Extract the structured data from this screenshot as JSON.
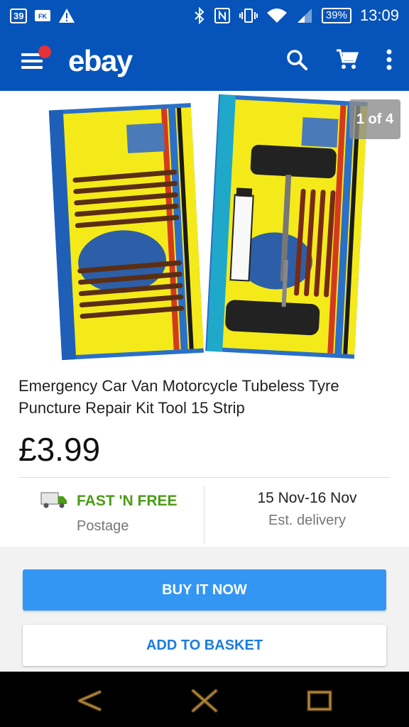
{
  "status_bar": {
    "notif_count": "39",
    "battery": "39%",
    "time": "13:09",
    "icons": [
      "badge-39-icon",
      "fk-icon",
      "warning-icon",
      "bluetooth-icon",
      "nfc-icon",
      "vibrate-icon",
      "wifi-icon",
      "signal-icon",
      "battery-icon"
    ]
  },
  "app_bar": {
    "logo": "ebay",
    "icons": [
      "menu-icon",
      "search-icon",
      "cart-icon",
      "more-vert-icon"
    ]
  },
  "gallery": {
    "counter": "1 of 4"
  },
  "item": {
    "title": "Emergency Car Van Motorcycle Tubeless Tyre Puncture Repair Kit Tool 15 Strip",
    "price": "£3.99"
  },
  "shipping": {
    "badge": "FAST 'N FREE",
    "label": "Postage"
  },
  "delivery": {
    "dates": "15 Nov-16 Nov",
    "label": "Est. delivery"
  },
  "actions": {
    "buy_now": "BUY IT NOW",
    "add_to_basket": "ADD TO BASKET"
  },
  "nav_bar": {
    "icons": [
      "back-icon",
      "home-icon",
      "recents-icon"
    ]
  },
  "colors": {
    "brand_blue": "#0654ba",
    "button_blue": "#3396f3",
    "fast_free_green": "#4a9c16",
    "menu_dot_red": "#e53238"
  }
}
